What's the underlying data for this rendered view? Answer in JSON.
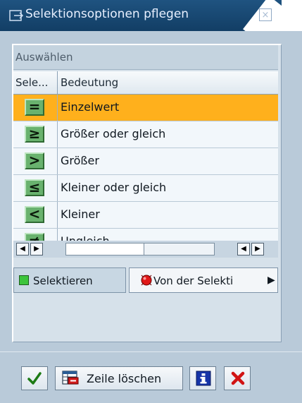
{
  "window": {
    "title": "Selektionsoptionen pflegen",
    "close_glyph": "×"
  },
  "group": {
    "title": "Auswählen"
  },
  "table": {
    "columns": [
      "Sele...",
      "Bedeutung"
    ],
    "rows": [
      {
        "symbol": "=",
        "label": "Einzelwert",
        "selected": true
      },
      {
        "symbol": "≥",
        "label": "Größer oder gleich",
        "selected": false
      },
      {
        "symbol": ">",
        "label": "Größer",
        "selected": false
      },
      {
        "symbol": "≤",
        "label": "Kleiner oder gleich",
        "selected": false
      },
      {
        "symbol": "<",
        "label": "Kleiner",
        "selected": false
      },
      {
        "symbol": "≠",
        "label": "Ungleich",
        "selected": false
      }
    ]
  },
  "scrollbar": {
    "left_arrow": "◀",
    "right_arrow": "▶"
  },
  "tabs": [
    {
      "label": "Selektieren",
      "icon": "green-square-icon",
      "active": true
    },
    {
      "label": "Von der Selekti",
      "icon": "red-stop-icon",
      "active": false
    }
  ],
  "tabs_more_arrow": "▶",
  "toolbar": {
    "delete_row_label": "Zeile löschen",
    "ok_icon": "checkmark-icon",
    "delete_icon": "delete-row-icon",
    "info_icon": "info-icon",
    "cancel_icon": "cancel-icon"
  },
  "colors": {
    "selected_row": "#ffb01c",
    "title_bar": "#1f5380",
    "dialog_bg": "#b9cad9",
    "op_button": "#69b26e"
  }
}
